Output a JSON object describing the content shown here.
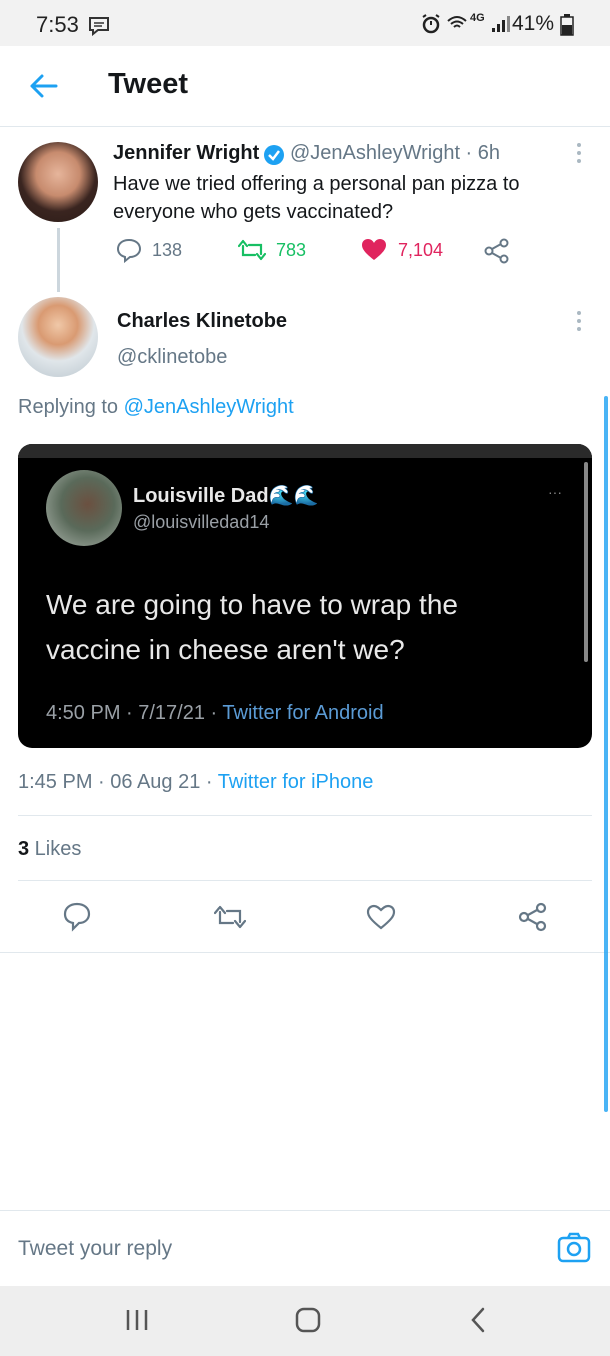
{
  "status_bar": {
    "time": "7:53",
    "signal": "4G",
    "battery": "41%"
  },
  "header": {
    "title": "Tweet"
  },
  "parent_tweet": {
    "name": "Jennifer Wright",
    "handle_time": "@JenAshleyWright · 6h",
    "text_line1": "Have we tried offering a personal pan pizza to",
    "text_line2": "everyone who gets vaccinated?",
    "replies": "138",
    "retweets": "783",
    "likes": "7,104"
  },
  "main_tweet": {
    "name": "Charles Klinetobe",
    "handle": "@cklinetobe",
    "replying_prefix": "Replying to ",
    "replying_to": "@JenAshleyWright",
    "timestamp": "1:45 PM · 06 Aug 21 · ",
    "source": "Twitter for iPhone",
    "likes_count": "3",
    "likes_label": " Likes"
  },
  "embedded_image": {
    "name": "Louisville Dad",
    "emoji": "🌊🌊",
    "handle": "@louisvilledad14",
    "text_line1": "We are going to have to wrap the",
    "text_line2": "vaccine in cheese aren't we?",
    "timestamp": "4:50 PM · 7/17/21 · ",
    "source": "Twitter for Android",
    "more": "···"
  },
  "reply_bar": {
    "placeholder": "Tweet your reply"
  },
  "colors": {
    "accent": "#1da1f2",
    "retweet": "#17bf63",
    "like": "#e0245e",
    "verified": "#1da1f2"
  }
}
